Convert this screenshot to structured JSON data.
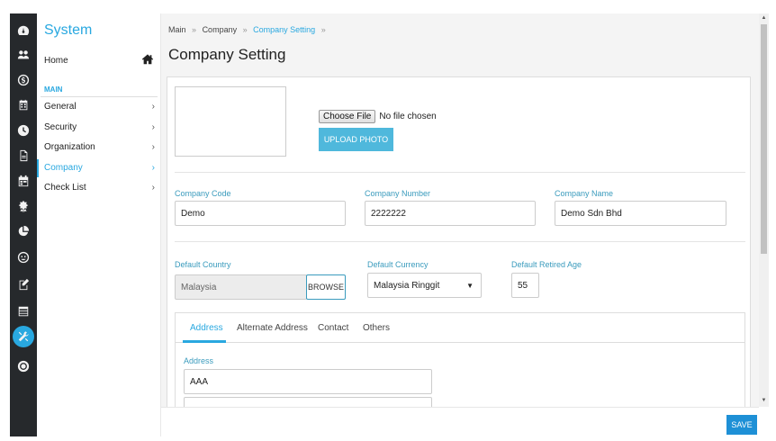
{
  "rail": {
    "icons": [
      "dashboard-icon",
      "people-icon",
      "dollar-icon",
      "calendar-icon",
      "clock-icon",
      "document-icon",
      "schedule-icon",
      "award-icon",
      "pie-chart-icon",
      "smiley-icon",
      "report-icon",
      "table-icon",
      "tools-icon",
      "help-icon"
    ],
    "active_index": 12
  },
  "sidebar": {
    "title": "System",
    "home_label": "Home",
    "section_label": "MAIN",
    "items": [
      {
        "label": "General",
        "chevron": "›"
      },
      {
        "label": "Security",
        "chevron": "›"
      },
      {
        "label": "Organization",
        "chevron": "›"
      },
      {
        "label": "Company",
        "chevron": "›"
      },
      {
        "label": "Check List",
        "chevron": "›"
      }
    ],
    "active_item": "Company"
  },
  "breadcrumb": {
    "items": [
      "Main",
      "Company",
      "Company Setting"
    ],
    "separator": "»"
  },
  "page_title": "Company Setting",
  "photo": {
    "file_button": "Choose File",
    "file_status": "No file chosen",
    "upload_label": "UPLOAD PHOTO"
  },
  "form": {
    "company_code": {
      "label": "Company Code",
      "value": "Demo"
    },
    "company_number": {
      "label": "Company Number",
      "value": "2222222"
    },
    "company_name": {
      "label": "Company Name",
      "value": "Demo Sdn Bhd"
    },
    "default_country": {
      "label": "Default Country",
      "value": "Malaysia",
      "button": "BROWSE"
    },
    "default_currency": {
      "label": "Default Currency",
      "value": "Malaysia Ringgit"
    },
    "default_retired_age": {
      "label": "Default Retired Age",
      "value": "55"
    }
  },
  "tabs": {
    "items": [
      "Address",
      "Alternate Address",
      "Contact",
      "Others"
    ],
    "active": "Address"
  },
  "address": {
    "label": "Address",
    "line1": "AAA",
    "line2": ""
  },
  "footer": {
    "save_label": "SAVE"
  },
  "colors": {
    "accent": "#29a8e0",
    "rail_bg": "#26292c",
    "save_button": "#1e90d6"
  }
}
